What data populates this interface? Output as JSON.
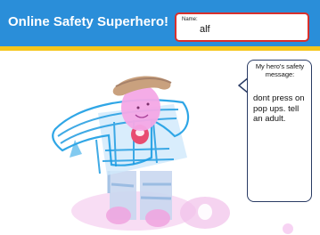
{
  "header": {
    "title": "Online Safety Superhero!",
    "background_color": "#2a8ed9",
    "stripe_color": "#f6c61b"
  },
  "name_field": {
    "label": "Name:",
    "value": "alf",
    "border_color": "#d9302c"
  },
  "drawing": {
    "description_icon": "child-drawing-of-superhero"
  },
  "speech_bubble": {
    "heading": "My hero's safety message:",
    "message": "dont press on pop ups. tell an adult."
  }
}
